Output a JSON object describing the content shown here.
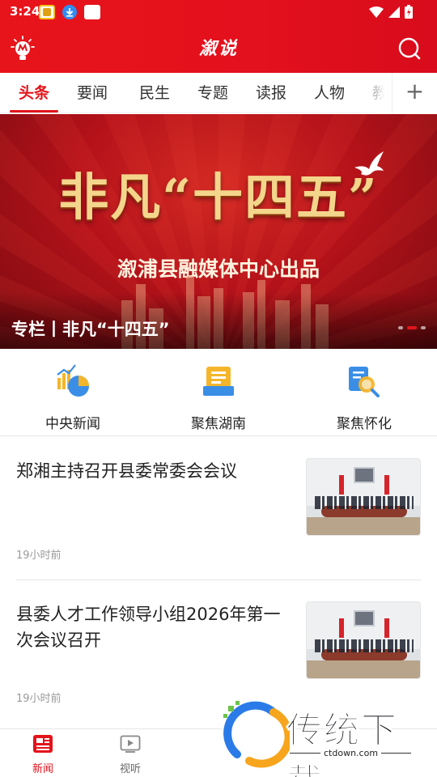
{
  "status_bar": {
    "time": "3:24"
  },
  "app": {
    "title": "溆说"
  },
  "tabs": [
    {
      "label": "头条",
      "active": true
    },
    {
      "label": "要闻",
      "active": false
    },
    {
      "label": "民生",
      "active": false
    },
    {
      "label": "专题",
      "active": false
    },
    {
      "label": "读报",
      "active": false
    },
    {
      "label": "人物",
      "active": false
    },
    {
      "label": "教育",
      "active": false
    }
  ],
  "banner": {
    "title": "非凡“十四五”",
    "subtitle": "溆浦县融媒体中心出品",
    "caption": "专栏丨非凡“十四五”",
    "slide_count": 3,
    "current_slide": 2
  },
  "quick_links": [
    {
      "label": "中央新闻",
      "icon": "chart-icon"
    },
    {
      "label": "聚焦湖南",
      "icon": "newspaper-icon"
    },
    {
      "label": "聚焦怀化",
      "icon": "magnifier-icon"
    }
  ],
  "news": [
    {
      "title": "郑湘主持召开县委常委会会议",
      "time": "19小时前",
      "image": "meeting-photo"
    },
    {
      "title": "县委人才工作领导小组2026年第一次会议召开",
      "time": "19小时前",
      "image": "meeting-photo"
    }
  ],
  "bottom_nav": [
    {
      "label": "新闻",
      "active": true,
      "icon": "news-icon"
    },
    {
      "label": "视听",
      "active": false,
      "icon": "video-icon"
    }
  ],
  "watermark": {
    "text": "传统下载",
    "url": "ctdown.com"
  },
  "colors": {
    "brand_red": "#e3141b",
    "gold": "#f4d58c"
  }
}
